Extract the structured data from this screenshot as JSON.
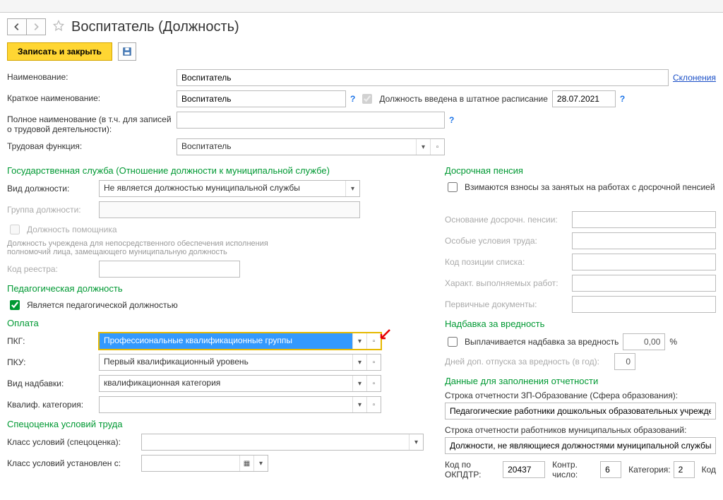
{
  "title": "Воспитатель (Должность)",
  "toolbar": {
    "save_close": "Записать и закрыть"
  },
  "labels": {
    "name": "Наименование:",
    "short_name": "Краткое наименование:",
    "full_name": "Полное наименование (в т.ч. для записей о трудовой деятельности):",
    "labor_func": "Трудовая функция:",
    "declensions": "Склонения",
    "in_staff": "Должность введена в штатное расписание"
  },
  "values": {
    "name": "Воспитатель",
    "short_name": "Воспитатель",
    "full_name": "",
    "labor_func": "Воспитатель",
    "staff_date": "28.07.2021"
  },
  "gov": {
    "heading": "Государственная служба (Отношение должности к муниципальной службе)",
    "position_kind_lbl": "Вид должности:",
    "position_kind": "Не является должностью муниципальной службы",
    "group_lbl": "Группа должности:",
    "helper_cb": "Должность помощника",
    "helper_desc": "Должность учреждена для непосредственного обеспечения исполнения полномочий лица, замещающего муниципальную должность",
    "registry_code_lbl": "Код реестра:"
  },
  "ped": {
    "heading": "Педагогическая должность",
    "is_ped": "Является педагогической должностью"
  },
  "pay": {
    "heading": "Оплата",
    "pkg_lbl": "ПКГ:",
    "pkg": "Профессиональные квалификационные группы",
    "pku_lbl": "ПКУ:",
    "pku": "Первый квалификационный уровень",
    "allowance_kind_lbl": "Вид надбавки:",
    "allowance_kind": "квалификационная категория",
    "qual_cat_lbl": "Квалиф. категория:"
  },
  "sout": {
    "heading": "Спецоценка условий труда",
    "class_lbl": "Класс условий (спецоценка):",
    "class_set_lbl": "Класс условий установлен с:"
  },
  "pension": {
    "heading": "Досрочная пенсия",
    "contrib_cb": "Взимаются взносы за занятых на работах с досрочной пенсией",
    "basis_lbl": "Основание досрочн. пенсии:",
    "special_cond_lbl": "Особые условия труда:",
    "list_pos_lbl": "Код позиции списка:",
    "work_char_lbl": "Характ. выполняемых работ:",
    "primary_docs_lbl": "Первичные документы:"
  },
  "hazard": {
    "heading": "Надбавка за вредность",
    "paid_cb": "Выплачивается надбавка за вредность",
    "value": "0,00",
    "pct": "%",
    "extra_days_lbl": "Дней доп. отпуска за вредность (в год):",
    "extra_days": "0"
  },
  "report": {
    "heading": "Данные для заполнения отчетности",
    "line_edu_lbl": "Строка отчетности ЗП-Образование (Сфера образования):",
    "line_edu": "Педагогические работники дошкольных образовательных учреждени",
    "line_mun_lbl": "Строка отчетности работников муниципальных образований:",
    "line_mun": "Должности, не являющиеся должностями муниципальной службы",
    "okpdtr_lbl": "Код по ОКПДТР:",
    "okpdtr": "20437",
    "check_num_lbl": "Контр. число:",
    "check_num": "6",
    "category_lbl": "Категория:",
    "category": "2",
    "code_lbl": "Код"
  }
}
